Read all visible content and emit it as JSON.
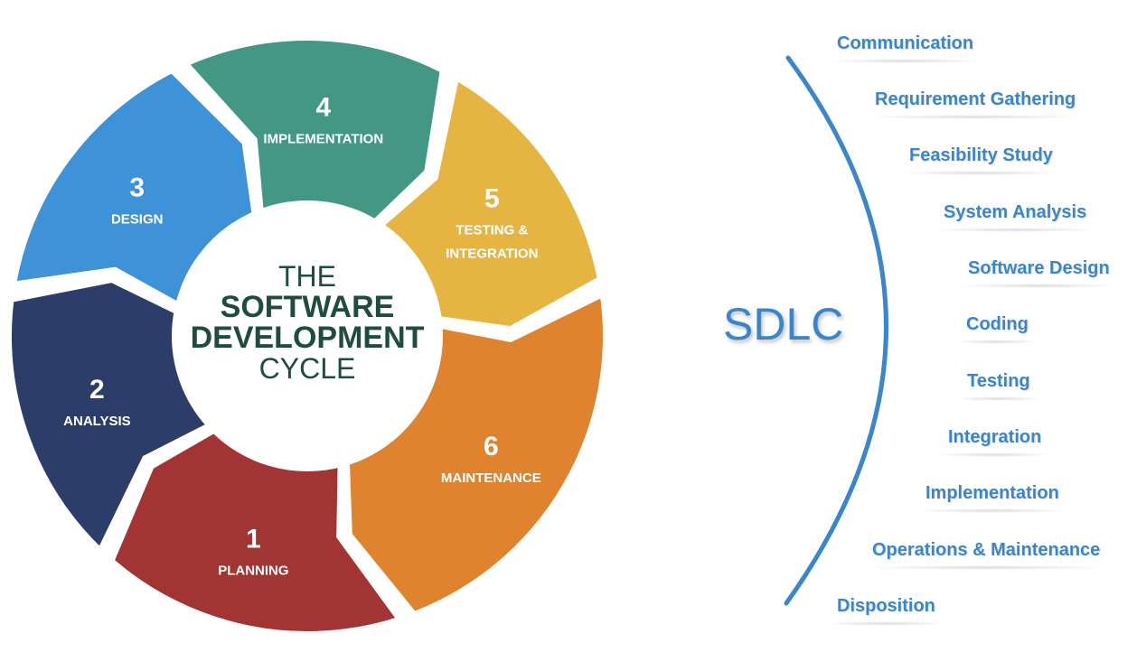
{
  "cycle": {
    "center": {
      "line1": "THE",
      "line2": "SOFTWARE",
      "line3": "DEVELOPMENT",
      "line4": "CYCLE",
      "text_color": "#1e4d3c"
    },
    "segments": [
      {
        "number": "1",
        "label_lines": [
          "PLANNING"
        ],
        "color": "#a33434"
      },
      {
        "number": "2",
        "label_lines": [
          "ANALYSIS"
        ],
        "color": "#2d3d69"
      },
      {
        "number": "3",
        "label_lines": [
          "DESIGN"
        ],
        "color": "#3d92d8"
      },
      {
        "number": "4",
        "label_lines": [
          "IMPLEMENTATION"
        ],
        "color": "#429885"
      },
      {
        "number": "5",
        "label_lines": [
          "TESTING &",
          "INTEGRATION"
        ],
        "color": "#e6b541"
      },
      {
        "number": "6",
        "label_lines": [
          "MAINTENANCE"
        ],
        "color": "#e0832f"
      }
    ]
  },
  "sdlc": {
    "title": "SDLC",
    "accent": "#3a86cc",
    "phases": [
      "Communication",
      "Requirement Gathering",
      "Feasibility Study",
      "System Analysis",
      "Software Design",
      "Coding",
      "Testing",
      "Integration",
      "Implementation",
      "Operations & Maintenance",
      "Disposition"
    ]
  }
}
